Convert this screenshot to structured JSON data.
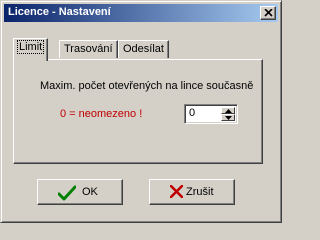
{
  "window": {
    "title": "Licence - Nastavení"
  },
  "titlebar": {
    "close_icon": "close-icon"
  },
  "tabs": [
    {
      "label": "Limit",
      "active": true
    },
    {
      "label": "Trasování",
      "active": false
    },
    {
      "label": "Odesílat",
      "active": false
    }
  ],
  "limit": {
    "label": "Maxim. počet otevřených na lince současně",
    "note": "0 = neomezeno !",
    "value": "0"
  },
  "buttons": {
    "ok_label": "OK",
    "cancel_label": "Zrušit"
  },
  "colors": {
    "title_start": "#0a246a",
    "title_end": "#a6caf0",
    "face": "#d4d0c8",
    "note": "#c00000",
    "ok_icon": "#008000",
    "cancel_icon": "#c00000"
  }
}
